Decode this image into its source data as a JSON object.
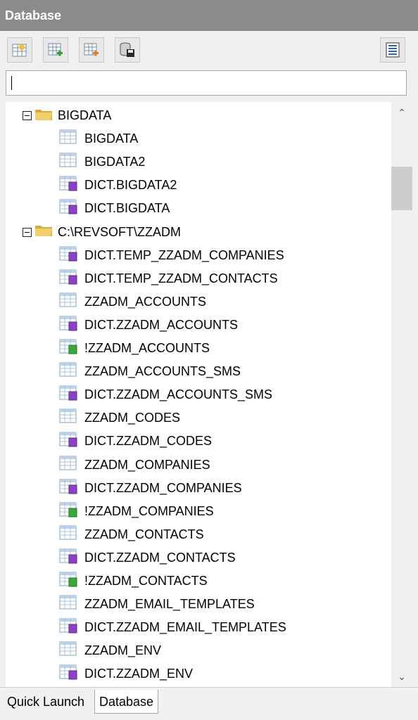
{
  "panel": {
    "title": "Database"
  },
  "toolbar": {
    "buttons": [
      {
        "name": "new-table-icon"
      },
      {
        "name": "add-table-icon"
      },
      {
        "name": "attach-table-icon"
      },
      {
        "name": "database-save-icon"
      }
    ],
    "list_button": {
      "name": "list-view-icon"
    }
  },
  "search": {
    "value": "",
    "placeholder": ""
  },
  "tree": {
    "groups": [
      {
        "label": "BIGDATA",
        "expanded": true,
        "items": [
          {
            "label": "BIGDATA",
            "type": "table"
          },
          {
            "label": "BIGDATA2",
            "type": "table"
          },
          {
            "label": "DICT.BIGDATA2",
            "type": "dict"
          },
          {
            "label": "DICT.BIGDATA",
            "type": "dict"
          }
        ]
      },
      {
        "label": "C:\\REVSOFT\\ZZADM",
        "expanded": true,
        "items": [
          {
            "label": "DICT.TEMP_ZZADM_COMPANIES",
            "type": "dict"
          },
          {
            "label": "DICT.TEMP_ZZADM_CONTACTS",
            "type": "dict"
          },
          {
            "label": "ZZADM_ACCOUNTS",
            "type": "table"
          },
          {
            "label": "DICT.ZZADM_ACCOUNTS",
            "type": "dict"
          },
          {
            "label": "!ZZADM_ACCOUNTS",
            "type": "index"
          },
          {
            "label": "ZZADM_ACCOUNTS_SMS",
            "type": "table"
          },
          {
            "label": "DICT.ZZADM_ACCOUNTS_SMS",
            "type": "dict"
          },
          {
            "label": "ZZADM_CODES",
            "type": "table"
          },
          {
            "label": "DICT.ZZADM_CODES",
            "type": "dict"
          },
          {
            "label": "ZZADM_COMPANIES",
            "type": "table"
          },
          {
            "label": "DICT.ZZADM_COMPANIES",
            "type": "dict"
          },
          {
            "label": "!ZZADM_COMPANIES",
            "type": "index"
          },
          {
            "label": "ZZADM_CONTACTS",
            "type": "table"
          },
          {
            "label": "DICT.ZZADM_CONTACTS",
            "type": "dict"
          },
          {
            "label": "!ZZADM_CONTACTS",
            "type": "index"
          },
          {
            "label": "ZZADM_EMAIL_TEMPLATES",
            "type": "table"
          },
          {
            "label": "DICT.ZZADM_EMAIL_TEMPLATES",
            "type": "dict"
          },
          {
            "label": "ZZADM_ENV",
            "type": "table"
          },
          {
            "label": "DICT.ZZADM_ENV",
            "type": "dict"
          }
        ]
      }
    ]
  },
  "tabs": [
    {
      "label": "Quick Launch",
      "active": false
    },
    {
      "label": "Database",
      "active": true
    }
  ],
  "colors": {
    "title_bar": "#8b8b8b",
    "folder": "#e8c35e",
    "dict_badge": "#8e3fc8",
    "index_badge": "#3aa83a",
    "table_header": "#3b8fd0"
  }
}
